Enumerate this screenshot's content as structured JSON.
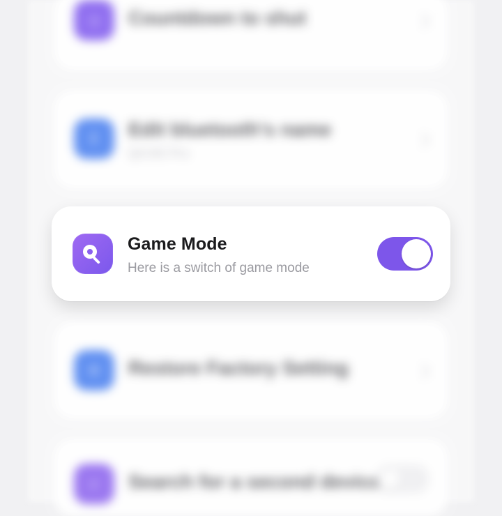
{
  "background_cards": [
    {
      "title": "Countdown to shut",
      "color": "#8f6df0"
    },
    {
      "title": "Edit bluetooth's name",
      "subtitle": "QCOD Pro",
      "color": "#5f8ff1"
    },
    {
      "title": "Restore Factory Setting",
      "color": "#5f8ff1"
    },
    {
      "title": "Search for a second device",
      "color": "#9a76f0"
    }
  ],
  "focused_card": {
    "title": "Game Mode",
    "subtitle": "Here is a switch of game mode",
    "switch_on": true,
    "accent_color": "#7d56ea",
    "icon": "search-icon"
  }
}
